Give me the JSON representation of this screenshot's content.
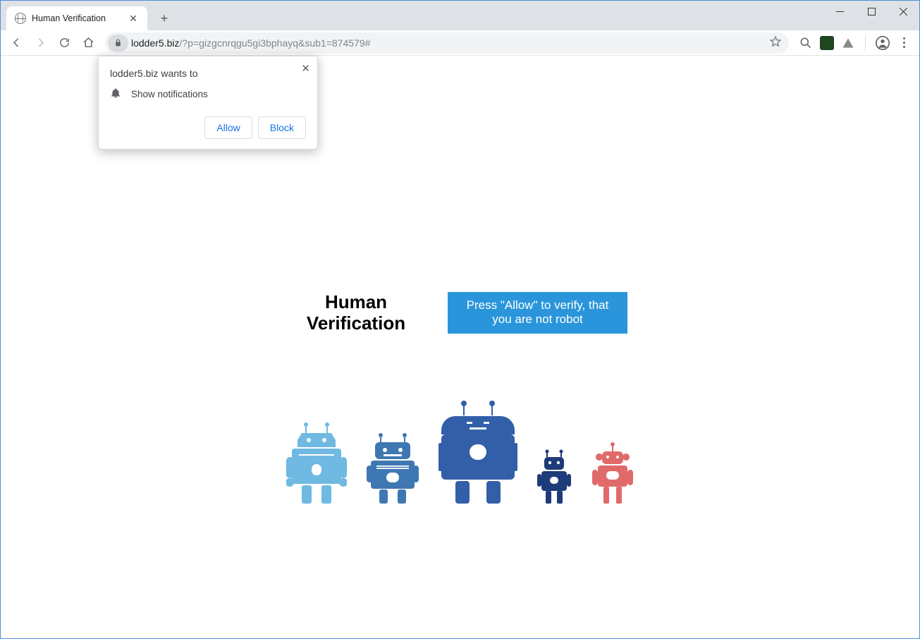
{
  "tab": {
    "title": "Human Verification"
  },
  "address": {
    "host": "lodder5.biz",
    "rest": "/?p=gizgcnrqgu5gi3bphayq&sub1=874579#"
  },
  "permission": {
    "title": "lodder5.biz wants to",
    "row_text": "Show notifications",
    "allow_label": "Allow",
    "block_label": "Block"
  },
  "page": {
    "heading": "Human Verification",
    "box_text": "Press \"Allow\" to verify, that you are not robot"
  },
  "robots": {
    "colors": [
      "#6fb9e2",
      "#3f77b3",
      "#335fa8",
      "#1e3b7a",
      "#e06a6a"
    ]
  }
}
